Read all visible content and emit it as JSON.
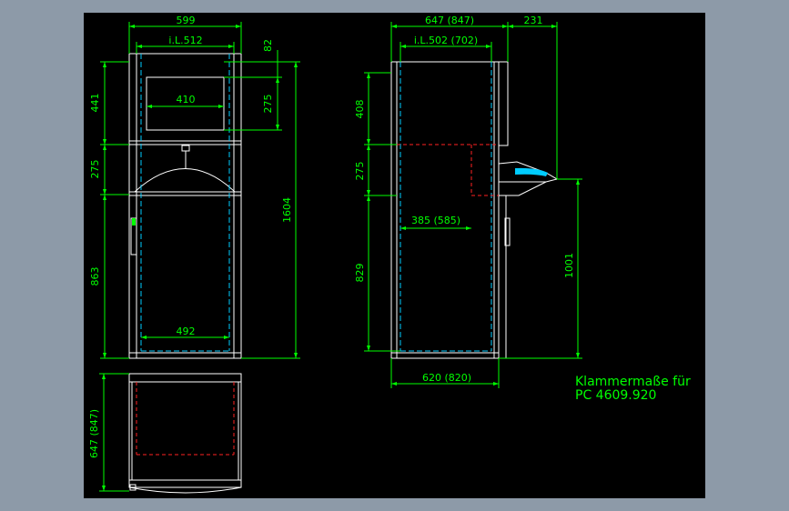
{
  "colors": {
    "background": "#8d9aa8",
    "canvas": "#000000",
    "outline": "#ffffff",
    "dimension": "#00ff00",
    "hidden_line": "#00ccff",
    "cut_line": "#ff2222",
    "note_text": "#00ff00"
  },
  "front_view": {
    "width_overall": "599",
    "width_inner": "i.L.512",
    "window_width": "410",
    "bottom_width": "492",
    "top_offset": "82",
    "window_height": "275",
    "upper_height": "441",
    "middle_height": "275",
    "lower_height": "863",
    "overall_height": "1604"
  },
  "side_view": {
    "depth_overall": "647 (847)",
    "depth_extra": "231",
    "depth_inner": "i.L.502 (702)",
    "upper_height": "408",
    "middle_height": "275",
    "lower_height": "829",
    "tray_depth": "385 (585)",
    "handle_height": "1001",
    "base_depth": "620 (820)"
  },
  "top_view": {
    "depth": "647 (847)"
  },
  "note": {
    "line1": "Klammermaße für",
    "line2": "PC 4609.920"
  }
}
